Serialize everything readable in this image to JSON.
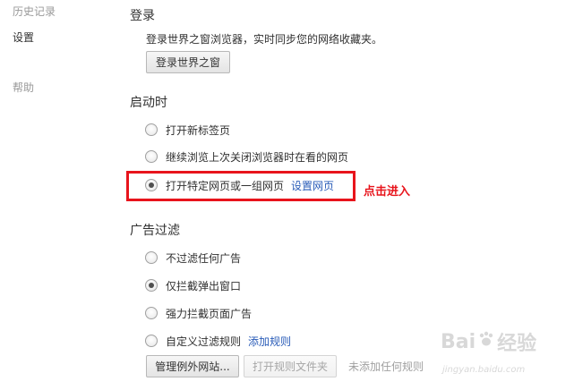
{
  "sidebar": {
    "items": [
      {
        "label": "历史记录"
      },
      {
        "label": "设置"
      },
      {
        "label": "帮助"
      }
    ]
  },
  "login": {
    "title": "登录",
    "description": "登录世界之窗浏览器，实时同步您的网络收藏夹。",
    "button_label": "登录世界之窗"
  },
  "startup": {
    "title": "启动时",
    "options": [
      {
        "label": "打开新标签页",
        "checked": false
      },
      {
        "label": "继续浏览上次关闭浏览器时在看的网页",
        "checked": false
      },
      {
        "label": "打开特定网页或一组网页",
        "checked": true,
        "link": "设置网页"
      }
    ]
  },
  "annotation": {
    "text": "点击进入",
    "color": "#e8141c"
  },
  "adfilter": {
    "title": "广告过滤",
    "options": [
      {
        "label": "不过滤任何广告",
        "checked": false
      },
      {
        "label": "仅拦截弹出窗口",
        "checked": true
      },
      {
        "label": "强力拦截页面广告",
        "checked": false
      },
      {
        "label": "自定义过滤规则",
        "checked": false,
        "link": "添加规则"
      }
    ],
    "manage_exceptions_label": "管理例外网站...",
    "open_rules_file_label": "打开规则文件夹",
    "no_rules_text": "未添加任何规则"
  },
  "watermark": {
    "logo_text": "Bai",
    "logo_text_2": "经验",
    "url": "jingyan.baidu.com"
  },
  "colors": {
    "link": "#2a5cb8",
    "accent_red": "#e8141c"
  }
}
